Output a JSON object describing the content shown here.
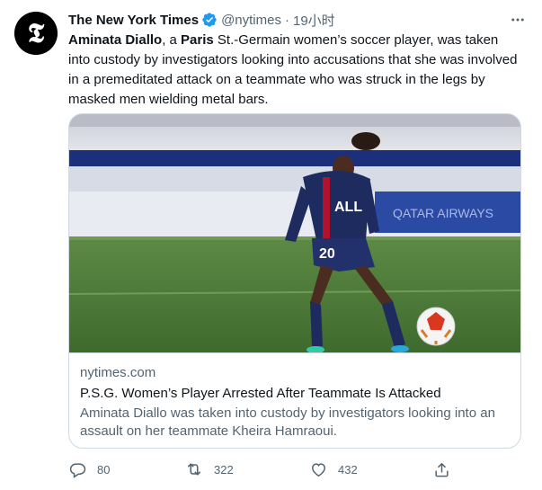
{
  "tweet": {
    "author": {
      "display_name": "The New York Times",
      "handle": "@nytimes",
      "separator": "·",
      "time": "19小时",
      "avatar_icon": "nyt-t-logo",
      "verified_color": "#1d9bf0"
    },
    "text": {
      "part1_bold": "Aminata Diallo",
      "part2": ", a ",
      "part3_bold": "Paris",
      "part4": " St.-Germain women’s soccer player, was taken into custody by investigators looking into accusations that she was involved in a premeditated attack on a teammate who was struck in the legs by masked men wielding metal bars."
    },
    "card": {
      "image_alt": "Soccer player in PSG kit dribbling a ball on a pitch",
      "jersey_sponsor": "ALL",
      "jersey_number": "20",
      "domain": "nytimes.com",
      "title": "P.S.G. Women’s Player Arrested After Teammate Is Attacked",
      "description": "Aminata Diallo was taken into custody by investigators looking into an assault on her teammate Kheira Hamraoui."
    },
    "actions": {
      "reply_count": "80",
      "retweet_count": "322",
      "like_count": "432",
      "reply_icon": "comment-icon",
      "retweet_icon": "retweet-icon",
      "like_icon": "heart-icon",
      "share_icon": "share-icon"
    },
    "colors": {
      "text_primary": "#0f1419",
      "text_secondary": "#536471",
      "border": "#cfd9de"
    }
  }
}
